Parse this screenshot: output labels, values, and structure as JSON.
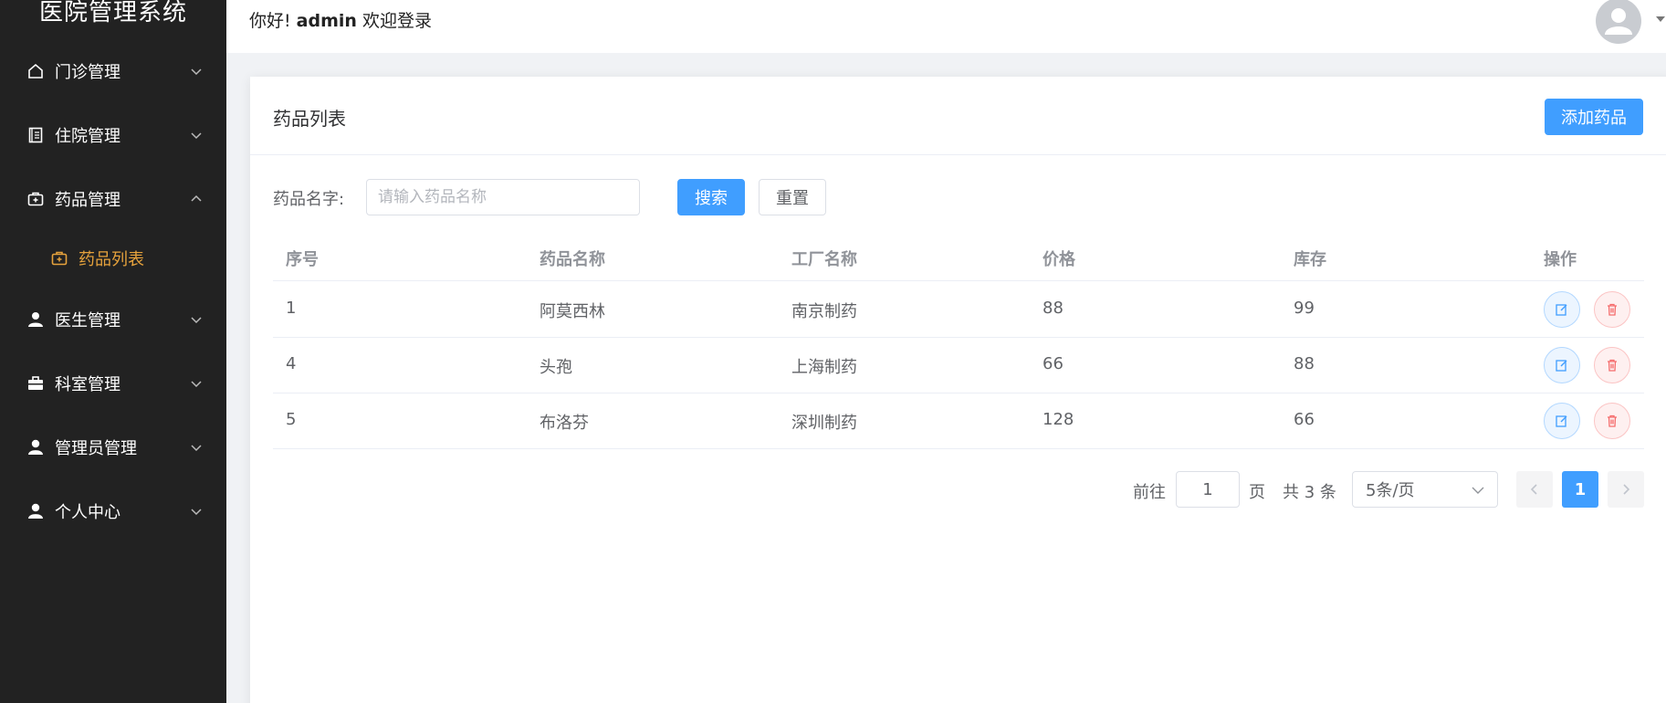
{
  "app": {
    "title": "医院管理系统"
  },
  "sidebar": {
    "items": [
      {
        "label": "门诊管理",
        "icon": "home-icon"
      },
      {
        "label": "住院管理",
        "icon": "document-icon"
      },
      {
        "label": "药品管理",
        "icon": "first-aid-kit-icon",
        "expanded": true
      },
      {
        "label": "医生管理",
        "icon": "doctor-icon"
      },
      {
        "label": "科室管理",
        "icon": "briefcase-icon"
      },
      {
        "label": "管理员管理",
        "icon": "user-icon"
      },
      {
        "label": "个人中心",
        "icon": "user-icon"
      }
    ],
    "sub_items": [
      {
        "label": "药品列表",
        "icon": "first-aid-kit-icon",
        "active": true
      }
    ],
    "active_color": "#e6a23c",
    "bg_color": "#222222"
  },
  "header": {
    "greeting_prefix": "你好!",
    "username": "admin",
    "greeting_suffix": "欢迎登录"
  },
  "card": {
    "title": "药品列表",
    "add_button": "添加药品"
  },
  "search": {
    "label": "药品名字:",
    "placeholder": "请输入药品名称",
    "search_button": "搜索",
    "reset_button": "重置"
  },
  "table": {
    "columns": [
      "序号",
      "药品名称",
      "工厂名称",
      "价格",
      "库存",
      "操作"
    ],
    "rows": [
      {
        "id": "1",
        "name": "阿莫西林",
        "factory": "南京制药",
        "price": "88",
        "stock": "99"
      },
      {
        "id": "4",
        "name": "头孢",
        "factory": "上海制药",
        "price": "66",
        "stock": "88"
      },
      {
        "id": "5",
        "name": "布洛芬",
        "factory": "深圳制药",
        "price": "128",
        "stock": "66"
      }
    ]
  },
  "pagination": {
    "goto_label": "前往",
    "page_value": "1",
    "page_unit": "页",
    "total_text": "共 3 条",
    "page_size": "5条/页",
    "current_page": "1"
  },
  "colors": {
    "primary": "#409eff",
    "danger": "#f56c6c"
  }
}
